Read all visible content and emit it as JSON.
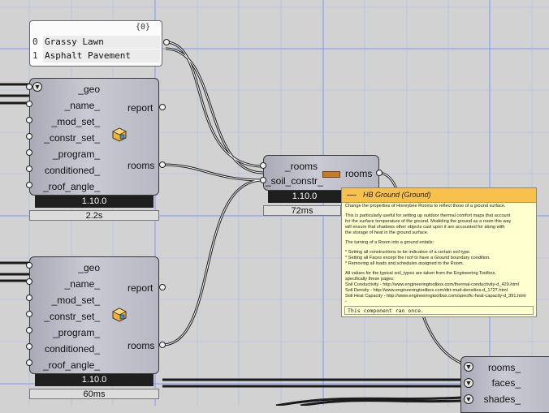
{
  "panel": {
    "header": "{0}",
    "items": [
      {
        "index": "0",
        "value": "Grassy Lawn"
      },
      {
        "index": "1",
        "value": "Asphalt Pavement"
      }
    ]
  },
  "room_a": {
    "inputs": [
      "_geo",
      "_name_",
      "_mod_set_",
      "_constr_set_",
      "_program_",
      "conditioned_",
      "_roof_angle_"
    ],
    "outputs": [
      "report",
      "rooms"
    ],
    "version": "1.10.0",
    "time": "2.2s"
  },
  "room_b": {
    "inputs": [
      "_geo",
      "_name_",
      "_mod_set_",
      "_constr_set_",
      "_program_",
      "conditioned_",
      "_roof_angle_"
    ],
    "outputs": [
      "report",
      "rooms"
    ],
    "version": "1.10.0",
    "time": "60ms"
  },
  "ground": {
    "inputs": [
      "_rooms",
      "_soil_constr_"
    ],
    "output": "rooms",
    "version": "1.10.0",
    "time": "72ms"
  },
  "partial": {
    "inputs": [
      "rooms_",
      "faces_",
      "shades_"
    ]
  },
  "tooltip": {
    "title": "HB Ground (Ground)",
    "paragraphs": [
      "Change the properties of Honeybee Rooms to reflect those of a ground surface.",
      "This is particularly useful for setting up outdoor thermal comfort maps that account\nfor the surface temperature of the ground. Modeling the ground as a room this way\nwill ensure that shadows other objects cast upon it are accounted for along with\nthe storage of heat in the ground surface.",
      "The turning of a Room into a ground entails:",
      "* Setting all constructions to be indicative of a certain soil type.\n* Setting all Faces except the roof to have a Ground boundary condition.\n* Removing all loads and schedules assigned to the Room.",
      "All values for the typical soil_types are taken from the Engineering Toolbox,\nspecifically these pages:\nSoil Conductivity - http://www.engineeringtoolbox.com/thermal-conductivity-d_429.html\nSoil Density - http://www.engineeringtoolbox.com/dirt-mud-densities-d_1727.html\nSoil Heat Capacity - http://www.engineeringtoolbox.com/specific-heat-capacity-d_391.html\n-"
    ],
    "footer": "This component ran once."
  },
  "icons": {
    "collapse": "down-arrow-icon",
    "honeybee": "honeybee-room-icon",
    "soil": "soil-construction-icon"
  },
  "colors": {
    "canvas": "#d2d2d2",
    "grid": "#6a8cff",
    "tooltip_header": "#f8c14c",
    "tooltip_body": "#ffffd0",
    "wire": "#1a1a1a"
  }
}
